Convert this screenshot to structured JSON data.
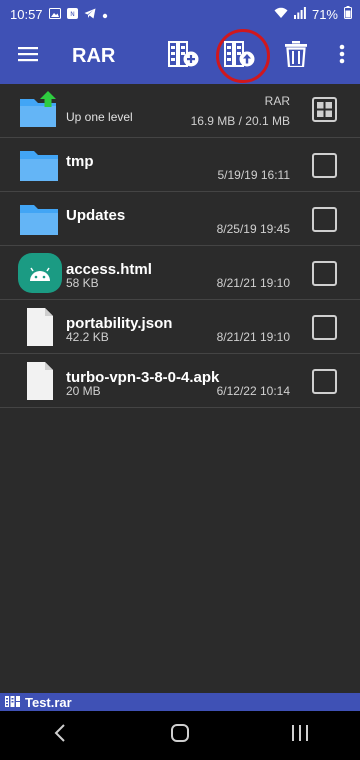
{
  "status_bar": {
    "time": "10:57",
    "battery": "71%",
    "icons_left": [
      "image-icon",
      "nfc-icon",
      "telegram-icon",
      "dot-icon"
    ],
    "icons_right": [
      "wifi-icon",
      "signal-icon",
      "battery-icon"
    ]
  },
  "toolbar": {
    "title": "RAR",
    "actions": [
      "add-to-archive-icon",
      "extract-icon",
      "delete-icon",
      "more-vert-icon"
    ],
    "highlighted_action": "extract-icon"
  },
  "up_row": {
    "label": "Up one level",
    "archive_type": "RAR",
    "size_info": "16.9 MB / 20.1 MB"
  },
  "files": [
    {
      "name": "tmp",
      "size": "",
      "date": "5/19/19 16:11",
      "type": "folder"
    },
    {
      "name": "Updates",
      "size": "",
      "date": "8/25/19 19:45",
      "type": "folder"
    },
    {
      "name": "access.html",
      "size": "58 KB",
      "date": "8/21/21 19:10",
      "type": "android"
    },
    {
      "name": "portability.json",
      "size": "42.2 KB",
      "date": "8/21/21 19:10",
      "type": "file"
    },
    {
      "name": "turbo-vpn-3-8-0-4.apk",
      "size": "20 MB",
      "date": "6/12/22 10:14",
      "type": "file"
    }
  ],
  "bottom_bar": {
    "archive_name": "Test.rar"
  },
  "colors": {
    "primary": "#3f51b5",
    "background": "#2b2b2b",
    "folder": "#42a5f5",
    "android_tile": "#1b9b83",
    "highlight": "#d0171d"
  }
}
